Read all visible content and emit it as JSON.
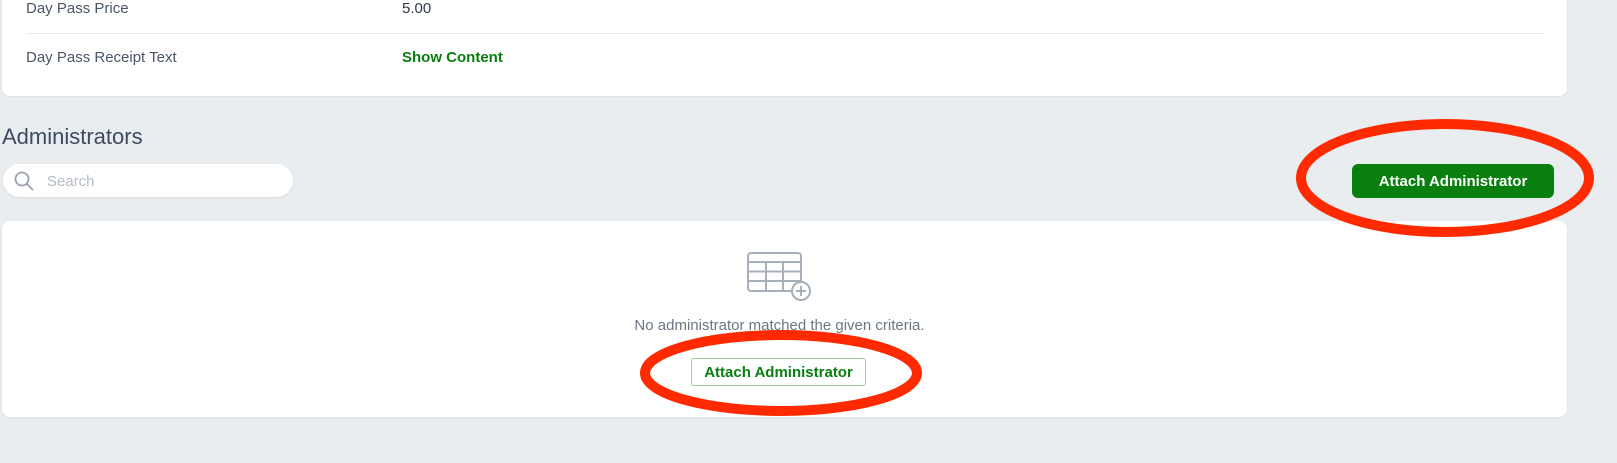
{
  "details": {
    "rows": [
      {
        "label": "Day Pass Price",
        "value": "5.00"
      },
      {
        "label": "Day Pass Receipt Text",
        "value": "Show Content"
      }
    ]
  },
  "administrators": {
    "title": "Administrators",
    "search": {
      "placeholder": "Search",
      "value": ""
    },
    "attach_button_label": "Attach Administrator",
    "empty_state": {
      "message": "No administrator matched the given criteria.",
      "attach_button_label": "Attach Administrator"
    }
  },
  "colors": {
    "accent": "#087f0f",
    "background": "#e9edf0",
    "annotation": "#ff2a00"
  },
  "icons": {
    "search": "search-icon",
    "table": "table-add-icon"
  }
}
